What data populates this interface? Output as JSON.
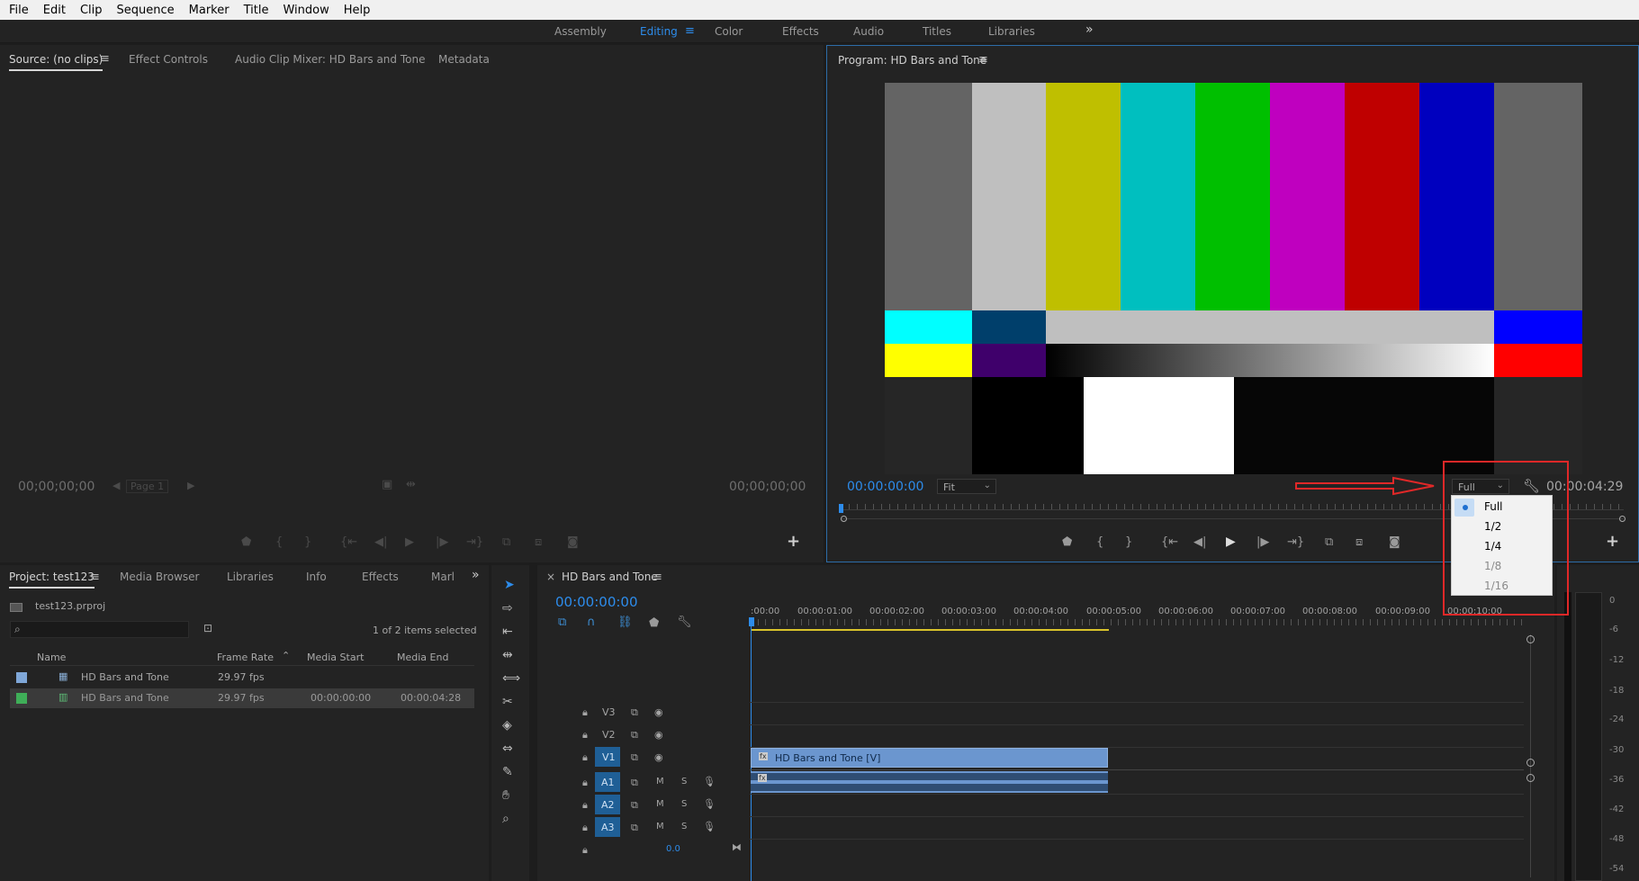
{
  "menu": [
    "File",
    "Edit",
    "Clip",
    "Sequence",
    "Marker",
    "Title",
    "Window",
    "Help"
  ],
  "workspaces": [
    "Assembly",
    "Editing",
    "Color",
    "Effects",
    "Audio",
    "Titles",
    "Libraries"
  ],
  "workspaces_more": "»",
  "source_panel": {
    "tabs": [
      "Source: (no clips)",
      "Effect Controls",
      "Audio Clip Mixer: HD Bars and Tone",
      "Metadata"
    ],
    "tc_left": "00;00;00;00",
    "tc_right": "00;00;00;00",
    "page": "Page 1"
  },
  "program_panel": {
    "title": "Program: HD Bars and Tone",
    "tc_current": "00:00:00:00",
    "zoom": "Fit",
    "resolution": "Full",
    "tc_duration": "00:00:04:29"
  },
  "resolution_menu": {
    "items": [
      "Full",
      "1/2",
      "1/4",
      "1/8",
      "1/16"
    ],
    "selected": "Full"
  },
  "project_panel": {
    "tabs": [
      "Project: test123",
      "Media Browser",
      "Libraries",
      "Info",
      "Effects",
      "Marl"
    ],
    "more": "»",
    "file": "test123.prproj",
    "search_placeholder": "",
    "selection_info": "1 of 2 items selected",
    "columns": [
      "Name",
      "Frame Rate",
      "Media Start",
      "Media End"
    ],
    "rows": [
      {
        "name": "HD Bars and Tone",
        "frame_rate": "29.97 fps",
        "media_start": "",
        "media_end": "",
        "color": "#7fa7d8"
      },
      {
        "name": "HD Bars and Tone",
        "frame_rate": "29.97 fps",
        "media_start": "00:00:00:00",
        "media_end": "00:00:04:28",
        "color": "#3fae58"
      }
    ]
  },
  "timeline": {
    "sequence": "HD Bars and Tone",
    "close": "×",
    "timecode": "00:00:00:00",
    "ruler": [
      ":00:00",
      "00:00:01:00",
      "00:00:02:00",
      "00:00:03:00",
      "00:00:04:00",
      "00:00:05:00",
      "00:00:06:00",
      "00:00:07:00",
      "00:00:08:00",
      "00:00:09:00",
      "00:00:10:00"
    ],
    "video_tracks": [
      "V3",
      "V2",
      "V1"
    ],
    "audio_tracks": [
      "A1",
      "A2",
      "A3"
    ],
    "mute": "M",
    "solo": "S",
    "master_volume": "0.0",
    "clip_video": "HD Bars and Tone [V]"
  },
  "meter_scale": [
    "0",
    "-6",
    "-12",
    "-18",
    "-24",
    "-30",
    "-36",
    "-42",
    "-48",
    "-54"
  ],
  "colors": {
    "accent": "#2d8ceb",
    "highlight_box": "#e02828"
  }
}
